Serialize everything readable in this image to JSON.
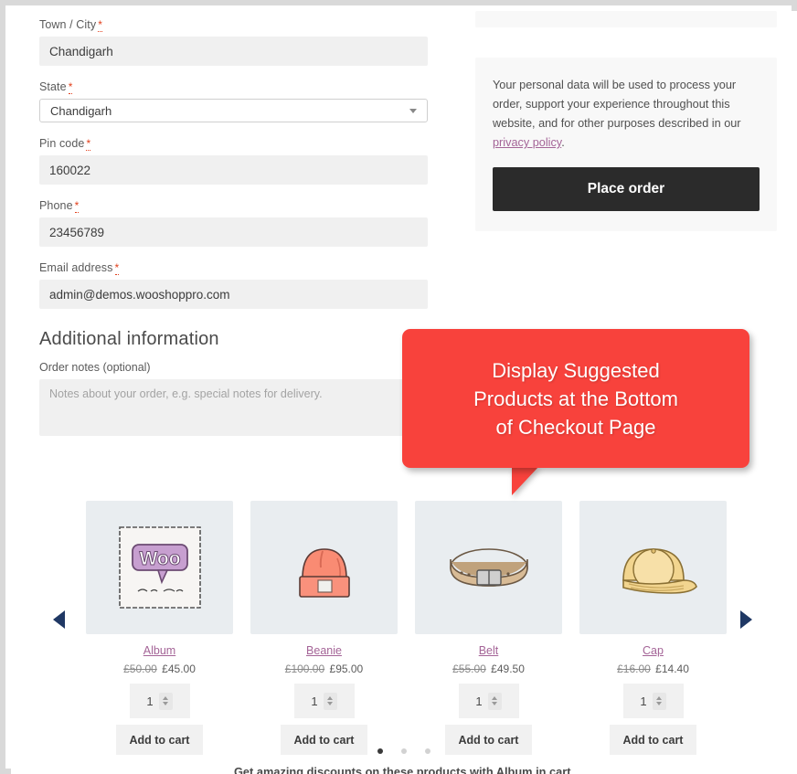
{
  "form": {
    "fields": [
      {
        "label": "Town / City",
        "required": true,
        "type": "text",
        "value": "Chandigarh"
      },
      {
        "label": "State",
        "required": true,
        "type": "select",
        "value": "Chandigarh"
      },
      {
        "label": "Pin code",
        "required": true,
        "type": "text",
        "value": "160022"
      },
      {
        "label": "Phone",
        "required": true,
        "type": "text",
        "value": "23456789"
      },
      {
        "label": "Email address",
        "required": true,
        "type": "text",
        "value": "admin@demos.wooshoppro.com"
      }
    ],
    "required_mark": "*",
    "additional": {
      "heading": "Additional information",
      "notes_label": "Order notes (optional)",
      "notes_placeholder": "Notes about your order, e.g. special notes for delivery.",
      "notes_value": ""
    }
  },
  "order_panel": {
    "privacy_text_before": "Your personal data will be used to process your order, support your experience throughout this website, and for other purposes described in our ",
    "privacy_link": "privacy policy",
    "privacy_text_after": ".",
    "place_order_label": "Place order"
  },
  "callout": {
    "line1": "Display Suggested",
    "line2": "Products at the Bottom",
    "line3": "of Checkout Page",
    "background": "#f8423c",
    "text_color": "#ffffff"
  },
  "carousel": {
    "prev_label": "◀",
    "next_label": "▶",
    "dots": [
      true,
      false,
      false
    ],
    "caption": "Get amazing discounts on these products with Album in cart.",
    "add_to_cart_label": "Add to cart",
    "quantity_value": "1",
    "products": [
      {
        "name": "Album",
        "old_price": "£50.00",
        "new_price": "£45.00",
        "image": "woo-album-art",
        "qty": "1"
      },
      {
        "name": "Beanie",
        "old_price": "£100.00",
        "new_price": "£95.00",
        "image": "beanie-art",
        "qty": "1"
      },
      {
        "name": "Belt",
        "old_price": "£55.00",
        "new_price": "£49.50",
        "image": "belt-art",
        "qty": "1"
      },
      {
        "name": "Cap",
        "old_price": "£16.00",
        "new_price": "£14.40",
        "image": "cap-art",
        "qty": "1"
      }
    ]
  }
}
